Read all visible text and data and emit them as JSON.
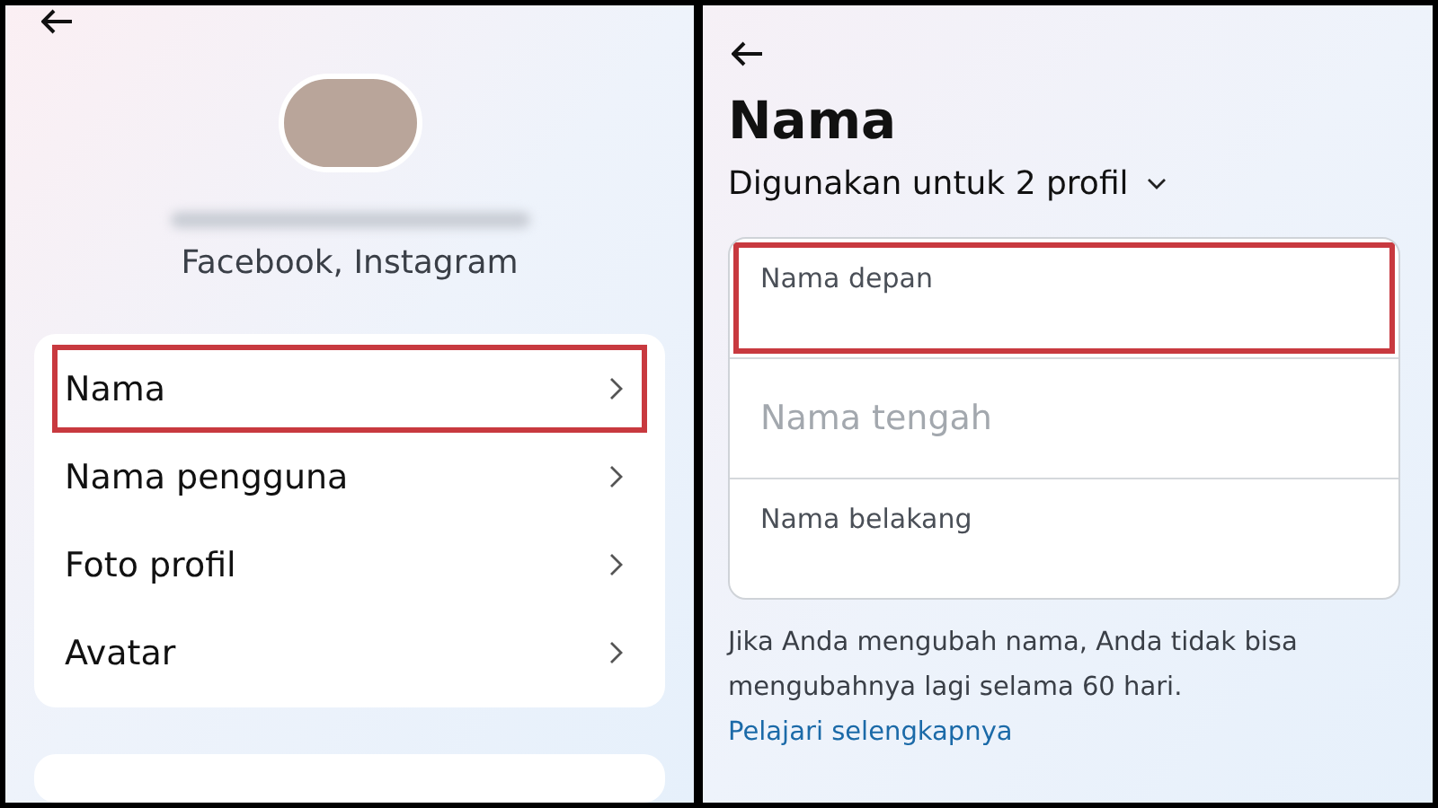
{
  "left_panel": {
    "profile_accounts": "Facebook, Instagram",
    "menu_items": [
      {
        "label": "Nama",
        "highlighted": true
      },
      {
        "label": "Nama pengguna",
        "highlighted": false
      },
      {
        "label": "Foto profil",
        "highlighted": false
      },
      {
        "label": "Avatar",
        "highlighted": false
      }
    ]
  },
  "right_panel": {
    "title": "Nama",
    "profiles_selector": "Digunakan untuk 2 profil",
    "fields": [
      {
        "kind": "label",
        "text": "Nama depan",
        "highlighted": true
      },
      {
        "kind": "placeholder",
        "text": "Nama tengah",
        "highlighted": false
      },
      {
        "kind": "label",
        "text": "Nama belakang",
        "highlighted": false
      }
    ],
    "notice": "Jika Anda mengubah nama, Anda tidak bisa mengubahnya lagi selama 60 hari.",
    "link": "Pelajari selengkapnya"
  }
}
